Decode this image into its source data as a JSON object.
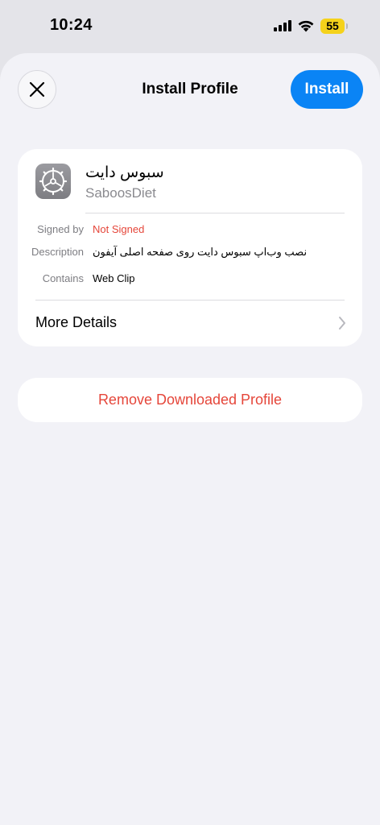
{
  "status_bar": {
    "time": "10:24",
    "battery": "55",
    "battery_color": "#f5d21b"
  },
  "header": {
    "title": "Install Profile",
    "install_label": "Install",
    "close_icon": "close-icon",
    "accent_color": "#0a84f5"
  },
  "profile": {
    "name": "سبوس دایت",
    "identifier": "SaboosDiet",
    "icon": "settings-gear-icon",
    "details": [
      {
        "key": "Signed by",
        "value": "Not Signed"
      },
      {
        "key": "Description",
        "value": "نصب وب‌اپ سبوس دایت روی صفحه اصلی آیفون"
      },
      {
        "key": "Contains",
        "value": "Web Clip"
      }
    ],
    "more_details_label": "More Details",
    "warning_color": "#e5463a"
  },
  "actions": {
    "remove_label": "Remove Downloaded Profile"
  }
}
